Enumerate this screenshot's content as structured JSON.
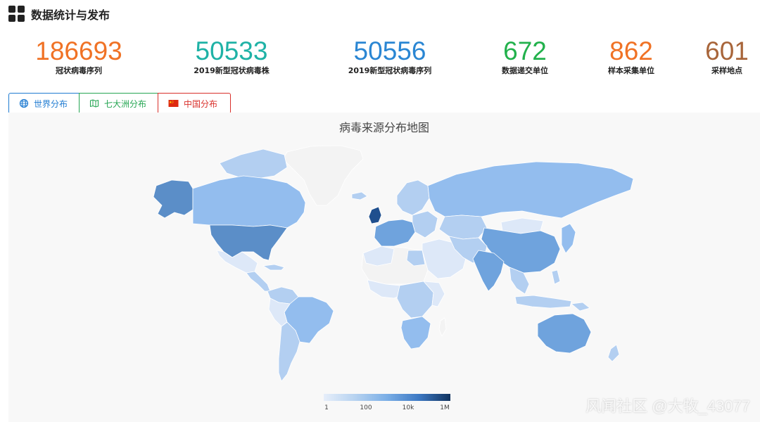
{
  "header": {
    "title": "数据统计与发布",
    "icon": "dashboard-grid-icon"
  },
  "stats": [
    {
      "value": "186693",
      "label": "冠状病毒序列",
      "color": "#f07225"
    },
    {
      "value": "50533",
      "label": "2019新型冠状病毒株",
      "color": "#1fb2a6"
    },
    {
      "value": "50556",
      "label": "2019新型冠状病毒序列",
      "color": "#2a86d3"
    },
    {
      "value": "672",
      "label": "数据递交单位",
      "color": "#22b14c"
    },
    {
      "value": "862",
      "label": "样本采集单位",
      "color": "#f07225"
    },
    {
      "value": "601",
      "label": "采样地点",
      "color": "#a8653a"
    }
  ],
  "tabs": [
    {
      "label": "世界分布",
      "icon": "globe-icon"
    },
    {
      "label": "七大洲分布",
      "icon": "map-icon"
    },
    {
      "label": "中国分布",
      "icon": "china-flag-icon"
    }
  ],
  "map": {
    "title": "病毒来源分布地图",
    "legend": {
      "ticks": [
        "1",
        "100",
        "10k",
        "1M"
      ],
      "scale": "log"
    },
    "colors": {
      "none": "#f3f3f3",
      "lowest": "#dde8f8",
      "low": "#b3cff1",
      "mid": "#93bdee",
      "midHigh": "#6fa3dd",
      "high": "#5b8ec8",
      "highest": "#1f4f8e"
    }
  },
  "watermark": "风闻社区 @大牧_43077"
}
